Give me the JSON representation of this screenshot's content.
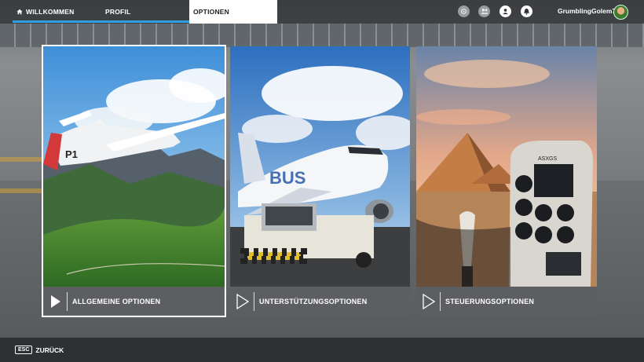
{
  "tabs": [
    {
      "label": "WILLKOMMEN",
      "icon": "home-icon"
    },
    {
      "label": "PROFIL"
    },
    {
      "label": "OPTIONEN",
      "active": true
    }
  ],
  "user": {
    "name": "GrumblingGolem7"
  },
  "header_icons": [
    "notification-icon-dim",
    "friends-icon-dim",
    "profile-icon",
    "notification-bell-icon"
  ],
  "cards": [
    {
      "label": "ALLGEMEINE OPTIONEN",
      "selected": true,
      "scene": "glider over alpine valley"
    },
    {
      "label": "UNTERSTÜTZUNGSOPTIONEN",
      "scene": "airliner with pushback tug"
    },
    {
      "label": "STEUERUNGSOPTIONEN",
      "scene": "cockpit view over pyramids"
    }
  ],
  "footer": {
    "key": "ESC",
    "label": "ZURÜCK"
  },
  "colors": {
    "accent": "#2f9fe0",
    "bar_bg": "#282a2d"
  }
}
